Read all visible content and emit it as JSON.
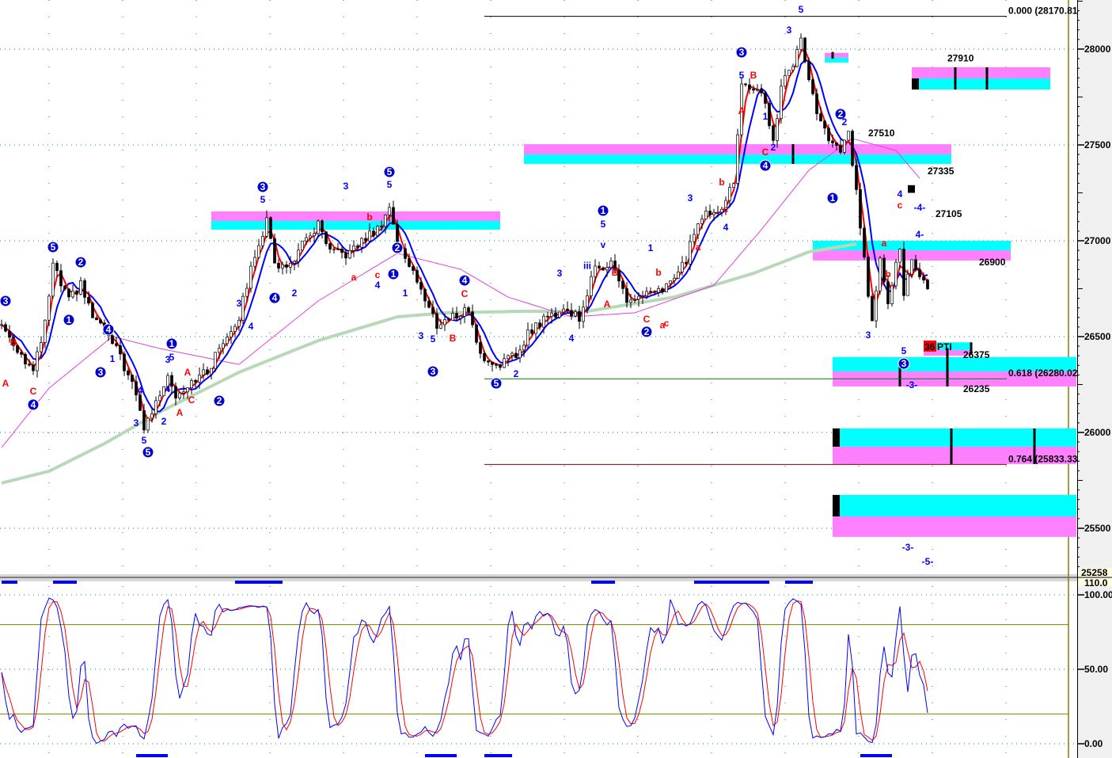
{
  "chart_data": {
    "type": "candlestick",
    "title": "",
    "price_axis": {
      "ylim": [
        25258,
        28256
      ],
      "ticks": [
        28000,
        27500,
        27000,
        26500,
        26000,
        25500
      ],
      "tick_labels": [
        "28000",
        "27500",
        "27000",
        "26500",
        "26000",
        "25500"
      ],
      "bottom_label": "25258"
    },
    "stoch_axis": {
      "ylim": [
        0,
        110
      ],
      "ticks": [
        100,
        50,
        0
      ],
      "tick_labels": [
        "100.00",
        "50.00",
        "0.00"
      ],
      "top_label": "110.0",
      "levels": [
        80,
        20
      ]
    },
    "bars_count": 235,
    "close_waypoints": [
      [
        0,
        26562
      ],
      [
        4,
        26438
      ],
      [
        8,
        26314
      ],
      [
        11,
        26562
      ],
      [
        13,
        26872
      ],
      [
        15,
        26769
      ],
      [
        17,
        26686
      ],
      [
        20,
        26769
      ],
      [
        23,
        26603
      ],
      [
        26,
        26521
      ],
      [
        30,
        26397
      ],
      [
        34,
        26190
      ],
      [
        36,
        26025
      ],
      [
        39,
        26149
      ],
      [
        42,
        26314
      ],
      [
        44,
        26190
      ],
      [
        48,
        26273
      ],
      [
        52,
        26314
      ],
      [
        56,
        26479
      ],
      [
        60,
        26603
      ],
      [
        64,
        26934
      ],
      [
        67,
        27099
      ],
      [
        69,
        26893
      ],
      [
        72,
        26851
      ],
      [
        76,
        26975
      ],
      [
        80,
        27079
      ],
      [
        83,
        26934
      ],
      [
        88,
        26934
      ],
      [
        92,
        27017
      ],
      [
        95,
        27058
      ],
      [
        98,
        27182
      ],
      [
        100,
        26975
      ],
      [
        104,
        26851
      ],
      [
        107,
        26686
      ],
      [
        110,
        26562
      ],
      [
        114,
        26603
      ],
      [
        118,
        26645
      ],
      [
        121,
        26397
      ],
      [
        125,
        26355
      ],
      [
        130,
        26397
      ],
      [
        133,
        26521
      ],
      [
        138,
        26603
      ],
      [
        142,
        26645
      ],
      [
        146,
        26603
      ],
      [
        150,
        26851
      ],
      [
        154,
        26893
      ],
      [
        158,
        26686
      ],
      [
        162,
        26707
      ],
      [
        166,
        26727
      ],
      [
        170,
        26810
      ],
      [
        173,
        26893
      ],
      [
        175,
        27058
      ],
      [
        178,
        27141
      ],
      [
        182,
        27182
      ],
      [
        185,
        27306
      ],
      [
        187,
        27802
      ],
      [
        190,
        27802
      ],
      [
        193,
        27719
      ],
      [
        195,
        27512
      ],
      [
        197,
        27802
      ],
      [
        200,
        27926
      ],
      [
        202,
        28050
      ],
      [
        204,
        27843
      ],
      [
        206,
        27678
      ],
      [
        209,
        27512
      ],
      [
        212,
        27471
      ],
      [
        214,
        27554
      ],
      [
        216,
        27265
      ],
      [
        218,
        26893
      ],
      [
        220,
        26562
      ],
      [
        222,
        26934
      ],
      [
        224,
        26686
      ],
      [
        227,
        26975
      ],
      [
        228,
        26727
      ],
      [
        230,
        26893
      ],
      [
        232,
        26789
      ],
      [
        234,
        26770
      ]
    ],
    "ma_long": [
      [
        0,
        25736
      ],
      [
        12,
        25798
      ],
      [
        26,
        25942
      ],
      [
        40,
        26107
      ],
      [
        60,
        26314
      ],
      [
        80,
        26479
      ],
      [
        100,
        26603
      ],
      [
        112,
        26624
      ],
      [
        132,
        26632
      ],
      [
        148,
        26632
      ],
      [
        170,
        26706
      ],
      [
        190,
        26830
      ],
      [
        204,
        26942
      ],
      [
        216,
        26983
      ]
    ],
    "ma_mid": [
      [
        0,
        25921
      ],
      [
        12,
        26231
      ],
      [
        28,
        26500
      ],
      [
        40,
        26438
      ],
      [
        60,
        26355
      ],
      [
        80,
        26686
      ],
      [
        100,
        26934
      ],
      [
        116,
        26851
      ],
      [
        128,
        26706
      ],
      [
        144,
        26603
      ],
      [
        160,
        26624
      ],
      [
        180,
        26768
      ],
      [
        192,
        27058
      ],
      [
        204,
        27368
      ],
      [
        215,
        27533
      ],
      [
        226,
        27471
      ],
      [
        232,
        27326
      ]
    ],
    "zones": [
      {
        "bars": [
          53,
          126
        ],
        "pink": [
          27153,
          27103
        ],
        "cyan": [
          27103,
          27058
        ]
      },
      {
        "bars": [
          132,
          240
        ],
        "pink": [
          27504,
          27450
        ],
        "cyan": [
          27450,
          27401
        ]
      },
      {
        "bars": [
          205,
          255
        ],
        "cyan": [
          27000,
          26950
        ],
        "pink": [
          26950,
          26897
        ]
      },
      {
        "bars": [
          230,
          265
        ],
        "pink": [
          27905,
          27847
        ],
        "cyan": [
          27847,
          27789
        ]
      },
      {
        "bars": [
          210,
          272
        ],
        "cyan": [
          26393,
          26318
        ],
        "pink": [
          26318,
          26240
        ]
      },
      {
        "bars": [
          210,
          272
        ],
        "cyan": [
          26021,
          25926
        ],
        "pink": [
          25926,
          25835
        ]
      },
      {
        "bars": [
          210,
          272
        ],
        "cyan": [
          25674,
          25562
        ],
        "pink": [
          25562,
          25455
        ]
      },
      {
        "bars": [
          208,
          214
        ],
        "pink": [
          27980,
          27955
        ],
        "cyan": [
          27955,
          27930
        ]
      },
      {
        "bars": [
          233,
          245
        ],
        "cyan": [
          26470,
          26430
        ],
        "pink": [
          26430,
          26400
        ]
      }
    ],
    "zone_ticks": [
      [
        241,
        27905,
        27789
      ],
      [
        249,
        27905,
        27789
      ],
      [
        200,
        27504,
        27401
      ],
      [
        240,
        26021,
        25835
      ],
      [
        261,
        26021,
        25835
      ],
      [
        239,
        26440,
        26240
      ],
      [
        227,
        26350,
        26240
      ],
      [
        245,
        26470,
        26410
      ],
      [
        210,
        27985,
        27950
      ]
    ],
    "zone_blocks": [
      [
        230,
        27847,
        27789
      ],
      [
        210,
        26021,
        25926
      ],
      [
        210,
        25674,
        25562
      ],
      [
        229,
        27290,
        27250
      ]
    ],
    "fib_lines": [
      {
        "label": "0.000 (28170.81",
        "price": 28170.81,
        "bars": [
          122,
          254
        ],
        "color": "#000000"
      },
      {
        "label": "0.618 (26280.02",
        "price": 26280.02,
        "bars": [
          122,
          254
        ],
        "color": "#008000"
      },
      {
        "label": "0.764 (25833.33",
        "price": 25833.33,
        "bars": [
          122,
          254
        ],
        "color": "#8b0000"
      }
    ],
    "price_labels": [
      {
        "text": "27910",
        "bar": 239,
        "price": 27935
      },
      {
        "text": "27510",
        "bar": 219,
        "price": 27546
      },
      {
        "text": "27335",
        "bar": 234,
        "price": 27347
      },
      {
        "text": "27105",
        "bar": 236,
        "price": 27124
      },
      {
        "text": "26900",
        "bar": 247,
        "price": 26872
      },
      {
        "text": "26375",
        "bar": 243,
        "price": 26388
      },
      {
        "text": "26235",
        "bar": 243,
        "price": 26210
      }
    ],
    "tag": {
      "num": "36",
      "text": "PTI",
      "bar": 233,
      "price": 26430
    },
    "wave_labels": [
      [
        "3",
        1,
        26686,
        "c"
      ],
      [
        "5",
        13,
        26967,
        "c"
      ],
      [
        "2",
        20,
        26888,
        "c"
      ],
      [
        "1",
        17,
        26587,
        "c"
      ],
      [
        "4",
        27,
        26537,
        "c"
      ],
      [
        "3",
        25,
        26314,
        "c"
      ],
      [
        "4",
        8,
        26145,
        "c"
      ],
      [
        "5",
        37,
        25897,
        "c"
      ],
      [
        "1",
        43,
        26463,
        "c"
      ],
      [
        "2",
        55,
        26165,
        "c"
      ],
      [
        "3",
        66,
        27281,
        "c"
      ],
      [
        "4",
        69,
        26702,
        "c"
      ],
      [
        "5",
        98,
        27359,
        "c"
      ],
      [
        "2",
        100,
        26963,
        "c"
      ],
      [
        "1",
        99,
        26826,
        "c"
      ],
      [
        "3",
        109,
        26318,
        "c"
      ],
      [
        "4",
        117,
        26793,
        "c"
      ],
      [
        "5",
        125,
        26256,
        "c"
      ],
      [
        "1",
        152,
        27157,
        "c"
      ],
      [
        "2",
        163,
        26525,
        "c"
      ],
      [
        "3",
        187,
        27983,
        "c"
      ],
      [
        "4",
        193,
        27392,
        "c"
      ],
      [
        "2",
        212,
        27661,
        "c"
      ],
      [
        "1",
        210,
        27223,
        "c"
      ],
      [
        "3",
        228,
        26359,
        "c"
      ],
      [
        "A",
        1,
        26256,
        "r"
      ],
      [
        "C",
        8,
        26215,
        "r"
      ],
      [
        "B",
        3,
        26471,
        "r"
      ],
      [
        "A",
        47,
        26314,
        "r"
      ],
      [
        "A",
        45,
        26103,
        "r"
      ],
      [
        "C",
        48,
        26169,
        "r"
      ],
      [
        "b",
        93,
        27124,
        "r"
      ],
      [
        "a",
        89,
        26810,
        "r"
      ],
      [
        "c",
        95,
        26822,
        "r"
      ],
      [
        "B",
        114,
        26492,
        "r"
      ],
      [
        "C",
        117,
        26723,
        "r"
      ],
      [
        "A",
        153,
        26669,
        "r"
      ],
      [
        "B",
        155,
        26835,
        "r"
      ],
      [
        "C",
        163,
        26591,
        "r"
      ],
      [
        "a",
        167,
        26560,
        "r"
      ],
      [
        "c",
        168,
        26570,
        "r"
      ],
      [
        "b",
        182,
        27306,
        "r"
      ],
      [
        "a",
        176,
        26967,
        "r"
      ],
      [
        "c",
        183,
        27165,
        "r"
      ],
      [
        "A",
        187,
        27678,
        "r"
      ],
      [
        "B",
        190,
        27863,
        "r"
      ],
      [
        "C",
        193,
        27463,
        "r"
      ],
      [
        "c",
        227,
        27186,
        "r"
      ],
      [
        "a",
        223,
        26988,
        "r"
      ],
      [
        "b",
        224,
        26826,
        "r"
      ],
      [
        "b",
        166,
        26835,
        "r"
      ],
      [
        "5",
        66,
        27215,
        "b"
      ],
      [
        "3",
        87,
        27285,
        "b"
      ],
      [
        "5",
        98,
        27293,
        "b"
      ],
      [
        "3",
        60,
        26673,
        "b"
      ],
      [
        "4",
        63,
        26554,
        "b"
      ],
      [
        "2",
        74,
        26727,
        "b"
      ],
      [
        "4",
        95,
        26768,
        "b"
      ],
      [
        "1",
        102,
        26727,
        "b"
      ],
      [
        "3",
        106,
        26504,
        "b"
      ],
      [
        "5",
        109,
        26488,
        "b"
      ],
      [
        "2",
        130,
        26306,
        "b"
      ],
      [
        "3",
        141,
        26830,
        "b"
      ],
      [
        "4",
        144,
        26492,
        "b"
      ],
      [
        "5",
        152,
        27087,
        "b"
      ],
      [
        "v",
        152,
        26979,
        "b"
      ],
      [
        "iii",
        148,
        26870,
        "b"
      ],
      [
        "1",
        164,
        26963,
        "b"
      ],
      [
        "3",
        174,
        27223,
        "b"
      ],
      [
        "4",
        183,
        27070,
        "b"
      ],
      [
        "5",
        187,
        27863,
        "b"
      ],
      [
        "3",
        199,
        28099,
        "b"
      ],
      [
        "5",
        202,
        28206,
        "b"
      ],
      [
        "2",
        195,
        27487,
        "b"
      ],
      [
        "1",
        193,
        27649,
        "b"
      ],
      [
        "2",
        213,
        27620,
        "b"
      ],
      [
        "3",
        219,
        26508,
        "b"
      ],
      [
        "5",
        228,
        26426,
        "b"
      ],
      [
        "4",
        227,
        27244,
        "b"
      ],
      [
        "3",
        34,
        26050,
        "b"
      ],
      [
        "5",
        36,
        25959,
        "b"
      ],
      [
        "4",
        35,
        26219,
        "b"
      ],
      [
        "2",
        41,
        26058,
        "b"
      ],
      [
        "4",
        42,
        26227,
        "b"
      ],
      [
        "5",
        43,
        26393,
        "b"
      ],
      [
        "3",
        42,
        26380,
        "b"
      ],
      [
        "1",
        28,
        26384,
        "b"
      ],
      [
        "-3-",
        230,
        26248,
        "b"
      ],
      [
        "-3-",
        229,
        25401,
        "b"
      ],
      [
        "-5-",
        234,
        25326,
        "b"
      ],
      [
        "-4-",
        232,
        27173,
        "b"
      ],
      [
        "4-",
        232,
        27033,
        "b"
      ]
    ],
    "signal_marks_top": [
      [
        0,
        4
      ],
      [
        13,
        19
      ],
      [
        59,
        71
      ],
      [
        149,
        155
      ],
      [
        175,
        194
      ],
      [
        198,
        205
      ]
    ],
    "signal_marks_bottom": [
      [
        34,
        42
      ],
      [
        107,
        115
      ],
      [
        122,
        129
      ],
      [
        217,
        225
      ]
    ],
    "colors": {
      "fast": "#ff0000",
      "slow": "#0000ff",
      "mid": "#e040e0",
      "long": "#b8d8b8",
      "pink": "#ff80ff",
      "cyan": "#00ffff",
      "wave_blue": "#0000ff",
      "wave_red": "#ff0000",
      "circle": "#0000cc"
    }
  }
}
